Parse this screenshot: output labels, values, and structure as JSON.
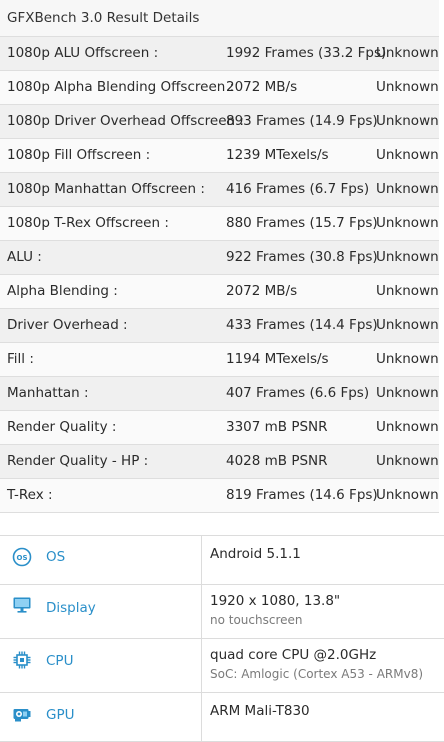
{
  "results": {
    "title": "GFXBench 3.0 Result Details",
    "rows": [
      {
        "name": "1080p ALU Offscreen :",
        "value": "1992 Frames (33.2 Fps)",
        "status": "Unknown"
      },
      {
        "name": "1080p Alpha Blending Offscreen :",
        "value": "2072 MB/s",
        "status": "Unknown"
      },
      {
        "name": "1080p Driver Overhead Offscreen :",
        "value": "893 Frames (14.9 Fps)",
        "status": "Unknown"
      },
      {
        "name": "1080p Fill Offscreen :",
        "value": "1239 MTexels/s",
        "status": "Unknown"
      },
      {
        "name": "1080p Manhattan Offscreen :",
        "value": "416 Frames (6.7 Fps)",
        "status": "Unknown"
      },
      {
        "name": "1080p T-Rex Offscreen :",
        "value": "880 Frames (15.7 Fps)",
        "status": "Unknown"
      },
      {
        "name": "ALU :",
        "value": "922 Frames (30.8 Fps)",
        "status": "Unknown"
      },
      {
        "name": "Alpha Blending :",
        "value": "2072 MB/s",
        "status": "Unknown"
      },
      {
        "name": "Driver Overhead :",
        "value": "433 Frames (14.4 Fps)",
        "status": "Unknown"
      },
      {
        "name": "Fill :",
        "value": "1194 MTexels/s",
        "status": "Unknown"
      },
      {
        "name": "Manhattan :",
        "value": "407 Frames (6.6 Fps)",
        "status": "Unknown"
      },
      {
        "name": "Render Quality :",
        "value": "3307 mB PSNR",
        "status": "Unknown"
      },
      {
        "name": "Render Quality - HP :",
        "value": "4028 mB PSNR",
        "status": "Unknown"
      },
      {
        "name": "T-Rex :",
        "value": "819 Frames (14.6 Fps)",
        "status": "Unknown"
      }
    ]
  },
  "specs": [
    {
      "label": "OS",
      "icon": "os-icon",
      "main": "Android 5.1.1",
      "sub": ""
    },
    {
      "label": "Display",
      "icon": "display-icon",
      "main": "1920 x 1080, 13.8\"",
      "sub": "no touchscreen"
    },
    {
      "label": "CPU",
      "icon": "cpu-icon",
      "main": "quad core CPU @2.0GHz",
      "sub": "SoC: Amlogic (Cortex A53 - ARMv8)"
    },
    {
      "label": "GPU",
      "icon": "gpu-icon",
      "main": "ARM Mali-T830",
      "sub": ""
    }
  ],
  "colors": {
    "accent": "#2a8fc9",
    "row_alt": "#f0f0f0",
    "border": "#dedede"
  }
}
